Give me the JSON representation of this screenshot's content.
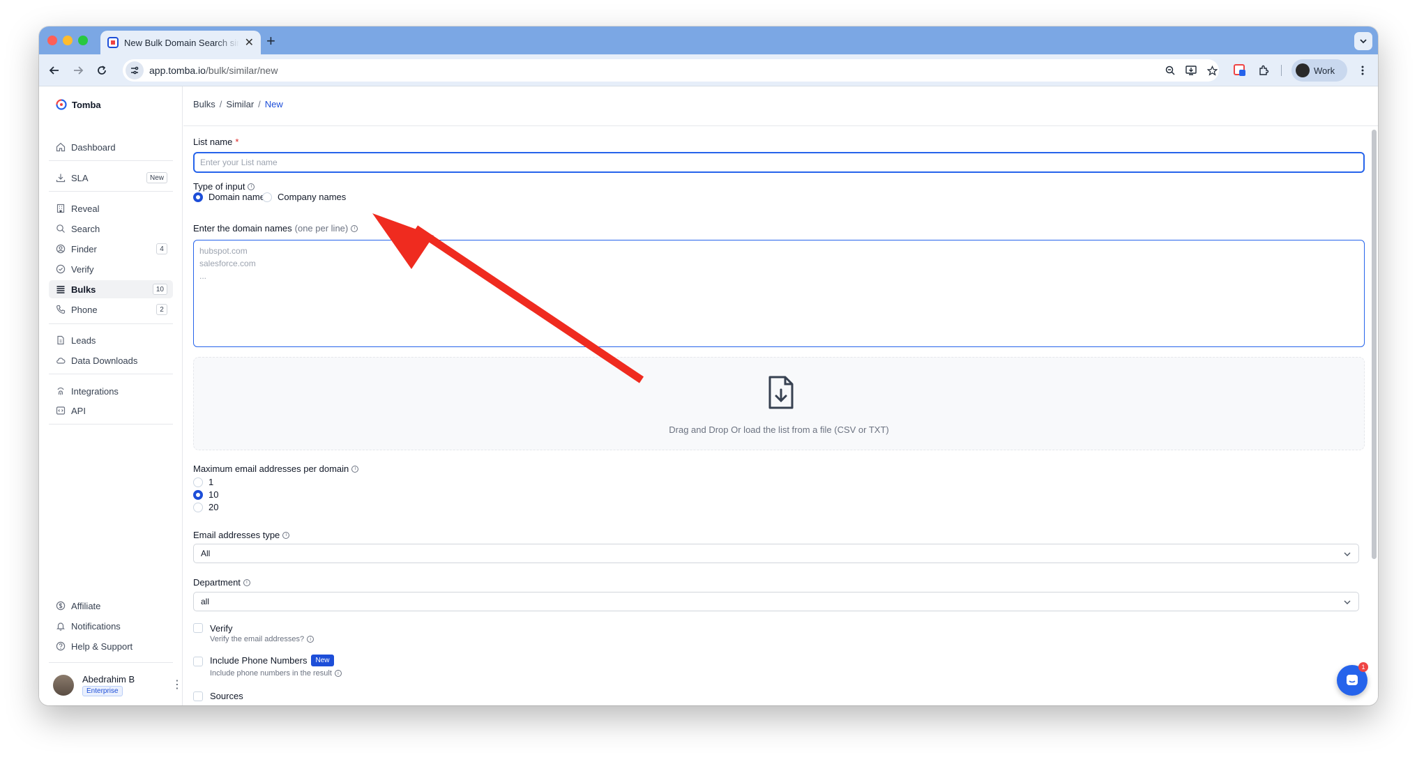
{
  "browser": {
    "tab_title": "New Bulk Domain Search similar",
    "url_host": "app.tomba.io",
    "url_path": "/bulk/similar/new",
    "profile_label": "Work"
  },
  "sidebar": {
    "brand": "Tomba",
    "items": [
      {
        "label": "Dashboard",
        "icon": "home-icon"
      },
      {
        "label": "SLA",
        "icon": "download-icon",
        "badge": "New"
      },
      {
        "label": "Reveal",
        "icon": "building-icon"
      },
      {
        "label": "Search",
        "icon": "search-icon"
      },
      {
        "label": "Finder",
        "icon": "user-circle-icon",
        "badge": "4"
      },
      {
        "label": "Verify",
        "icon": "check-circle-icon"
      },
      {
        "label": "Bulks",
        "icon": "stack-icon",
        "badge": "10",
        "active": true
      },
      {
        "label": "Phone",
        "icon": "phone-icon",
        "badge": "2"
      },
      {
        "label": "Leads",
        "icon": "file-icon"
      },
      {
        "label": "Data Downloads",
        "icon": "cloud-icon"
      },
      {
        "label": "Integrations",
        "icon": "fingerprint-icon"
      },
      {
        "label": "API",
        "icon": "code-icon"
      },
      {
        "label": "Affiliate",
        "icon": "dollar-icon"
      },
      {
        "label": "Notifications",
        "icon": "bell-icon"
      },
      {
        "label": "Help & Support",
        "icon": "help-icon"
      }
    ],
    "user": {
      "name": "Abedrahim B",
      "plan": "Enterprise"
    }
  },
  "breadcrumb": {
    "items": [
      "Bulks",
      "Similar",
      "New"
    ]
  },
  "form": {
    "list_name": {
      "label": "List name",
      "required_mark": "*",
      "placeholder": "Enter your List name",
      "value": ""
    },
    "type_of_input": {
      "label": "Type of input",
      "options": [
        "Domain names",
        "Company names"
      ],
      "selected": "Domain names"
    },
    "domains": {
      "label": "Enter the domain names",
      "hint": "(one per line)",
      "placeholder": "hubspot.com\nsalesforce.com\n..."
    },
    "dropzone": {
      "text": "Drag and Drop Or load the list from a file (CSV or TXT)"
    },
    "max_emails": {
      "label": "Maximum email addresses per domain",
      "options": [
        "1",
        "10",
        "20"
      ],
      "selected": "10"
    },
    "email_type": {
      "label": "Email addresses type",
      "value": "All"
    },
    "department": {
      "label": "Department",
      "value": "all"
    },
    "verify": {
      "label": "Verify",
      "sub": "Verify the email addresses?"
    },
    "phone": {
      "label": "Include Phone Numbers",
      "badge": "New",
      "sub": "Include phone numbers in the result"
    },
    "sources": {
      "label": "Sources"
    }
  },
  "chat": {
    "badge": "1"
  },
  "colors": {
    "accent": "#1d4ed8",
    "annotation_arrow": "#ef2b1f",
    "tab_strip": "#7ba7e4"
  }
}
